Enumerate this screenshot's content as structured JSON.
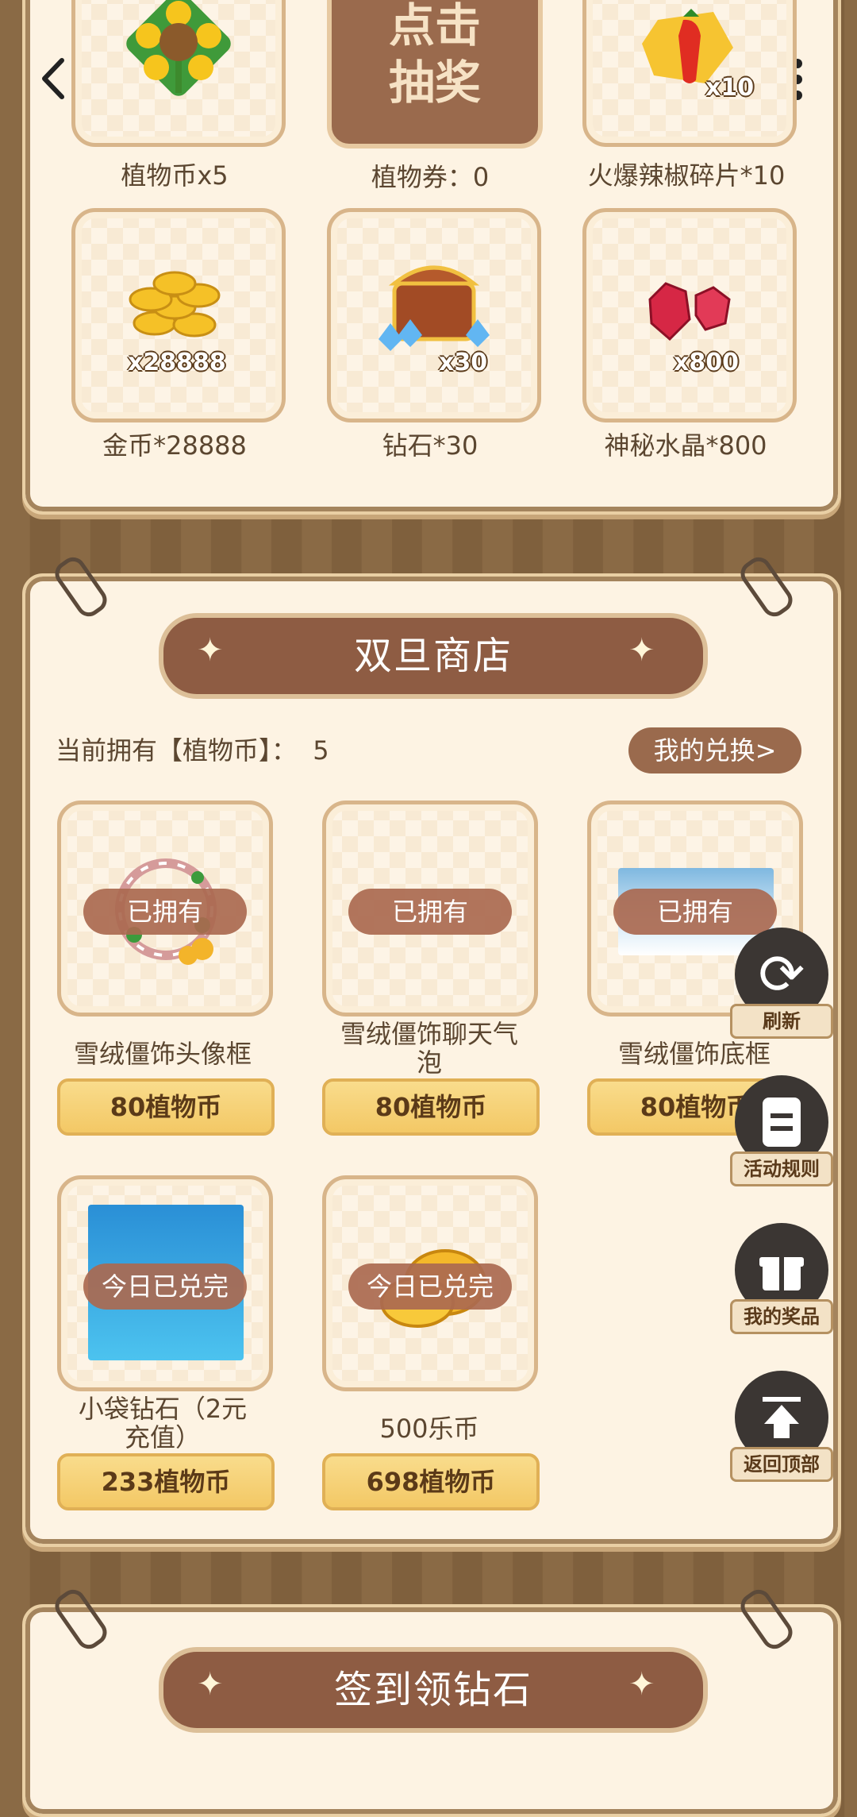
{
  "header": {
    "back_icon": "chevron-left-icon",
    "more_icon": "more-vertical-icon"
  },
  "prizes": {
    "row1": [
      {
        "label": "植物币x5",
        "icon": "sunflower-icon"
      },
      {
        "button_lines": [
          "点击",
          "抽奖"
        ],
        "label": "植物券：0"
      },
      {
        "label": "火爆辣椒碎片*10",
        "qty": "x10",
        "icon": "pepper-icon"
      }
    ],
    "row2": [
      {
        "label": "金币*28888",
        "qty": "x28888",
        "icon": "coins-icon"
      },
      {
        "label": "钻石*30",
        "qty": "x30",
        "icon": "treasure-chest-icon"
      },
      {
        "label": "神秘水晶*800",
        "qty": "x800",
        "icon": "crystal-icon"
      }
    ]
  },
  "shop": {
    "title": "双旦商店",
    "balance_label": "当前拥有【植物币】：",
    "balance_value": "5",
    "my_exchange": "我的兑换>",
    "items": [
      {
        "name": "雪绒僵饰头像框",
        "status": "已拥有",
        "price": "80植物币"
      },
      {
        "name_lines": [
          "雪绒僵饰聊天气",
          "泡"
        ],
        "status": "已拥有",
        "price": "80植物币"
      },
      {
        "name": "雪绒僵饰底框",
        "status": "已拥有",
        "price": "80植物币"
      },
      {
        "name_lines": [
          "小袋钻石（2元",
          "充值）"
        ],
        "status": "今日已兑完",
        "price": "233植物币"
      },
      {
        "name": "500乐币",
        "status": "今日已兑完",
        "price": "698植物币"
      }
    ]
  },
  "signin": {
    "title": "签到领钻石"
  },
  "side": [
    {
      "label": "刷新",
      "icon": "refresh-icon"
    },
    {
      "label": "活动规则",
      "icon": "document-icon"
    },
    {
      "label": "我的奖品",
      "icon": "gift-icon"
    },
    {
      "label": "返回顶部",
      "icon": "arrow-up-icon"
    }
  ]
}
